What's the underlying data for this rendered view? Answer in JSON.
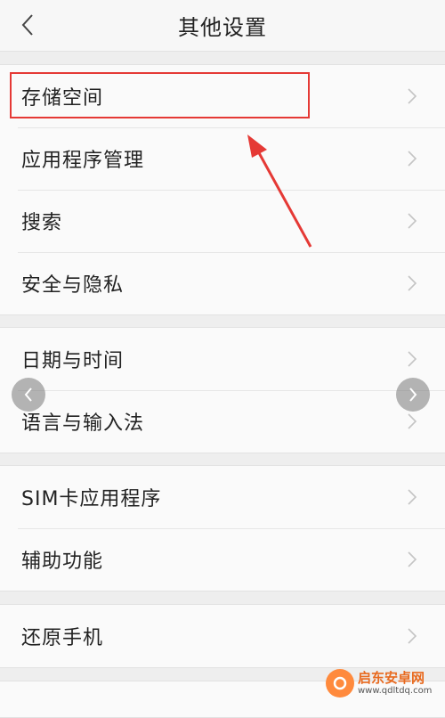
{
  "header": {
    "title": "其他设置",
    "back_icon": "chevron-left-icon"
  },
  "groups": [
    {
      "items": [
        {
          "label": "存储空间"
        },
        {
          "label": "应用程序管理"
        },
        {
          "label": "搜索"
        },
        {
          "label": "安全与隐私"
        }
      ]
    },
    {
      "items": [
        {
          "label": "日期与时间"
        },
        {
          "label": "语言与输入法"
        }
      ]
    },
    {
      "items": [
        {
          "label": "SIM卡应用程序"
        },
        {
          "label": "辅助功能"
        }
      ]
    },
    {
      "items": [
        {
          "label": "还原手机"
        }
      ]
    },
    {
      "items": [
        {
          "label": ""
        }
      ]
    }
  ],
  "annotation": {
    "color": "#e53935"
  },
  "watermark": {
    "title": "启东安卓网",
    "url": "www.qdltdq.com"
  },
  "colors": {
    "background": "#eeeeee",
    "row": "#fafafa",
    "chevron": "#c4c4c4"
  }
}
